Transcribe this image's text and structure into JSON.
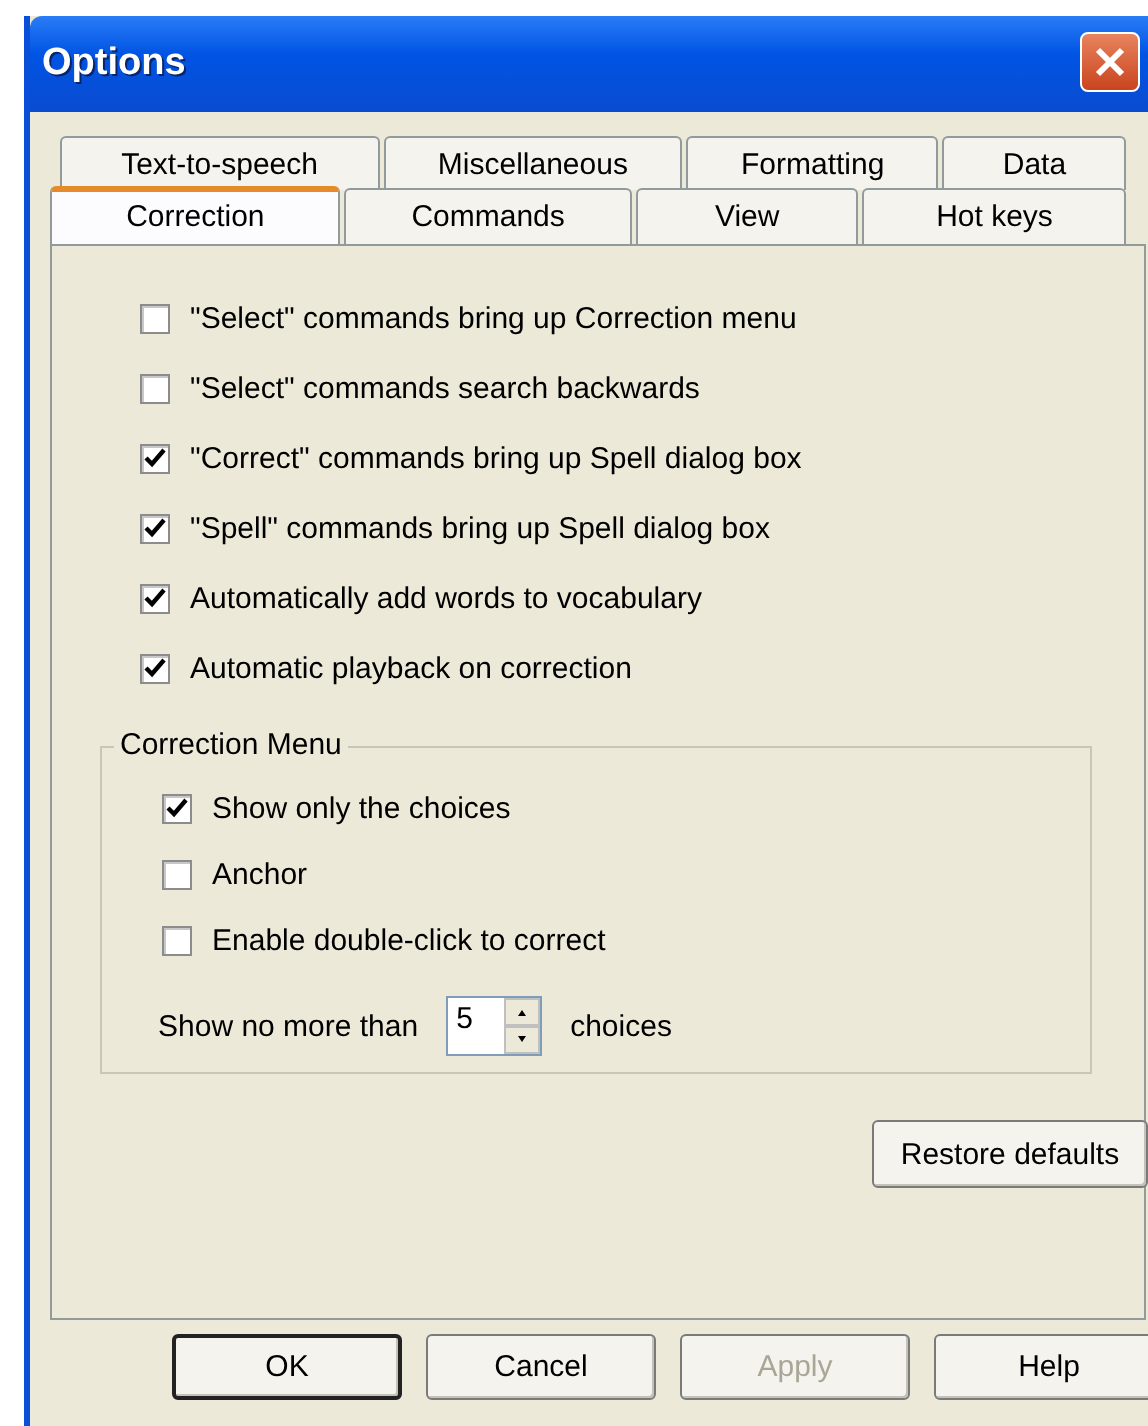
{
  "window": {
    "title": "Options"
  },
  "tab_rows": [
    [
      {
        "label": "Text-to-speech",
        "selected": false
      },
      {
        "label": "Miscellaneous",
        "selected": false
      },
      {
        "label": "Formatting",
        "selected": false
      },
      {
        "label": "Data",
        "selected": false
      }
    ],
    [
      {
        "label": "Correction",
        "selected": true
      },
      {
        "label": "Commands",
        "selected": false
      },
      {
        "label": "View",
        "selected": false
      },
      {
        "label": "Hot keys",
        "selected": false
      }
    ]
  ],
  "options": [
    {
      "label": "\"Select\" commands bring up Correction menu",
      "checked": false
    },
    {
      "label": "\"Select\" commands search backwards",
      "checked": false
    },
    {
      "label": "\"Correct\" commands bring up Spell dialog box",
      "checked": true
    },
    {
      "label": "\"Spell\" commands bring up Spell dialog box",
      "checked": true
    },
    {
      "label": "Automatically add words to vocabulary",
      "checked": true
    },
    {
      "label": "Automatic playback on correction",
      "checked": true
    }
  ],
  "correction_menu": {
    "title": "Correction Menu",
    "options": [
      {
        "label": "Show only the choices",
        "checked": true
      },
      {
        "label": "Anchor",
        "checked": false
      },
      {
        "label": "Enable double-click to correct",
        "checked": false
      }
    ],
    "limit": {
      "label": "Show no more than",
      "value": "5",
      "suffix": "choices"
    }
  },
  "restore_button": "Restore defaults",
  "buttons": [
    {
      "label": "OK",
      "default": true,
      "disabled": false
    },
    {
      "label": "Cancel",
      "default": false,
      "disabled": false
    },
    {
      "label": "Apply",
      "default": false,
      "disabled": true
    },
    {
      "label": "Help",
      "default": false,
      "disabled": false
    }
  ]
}
